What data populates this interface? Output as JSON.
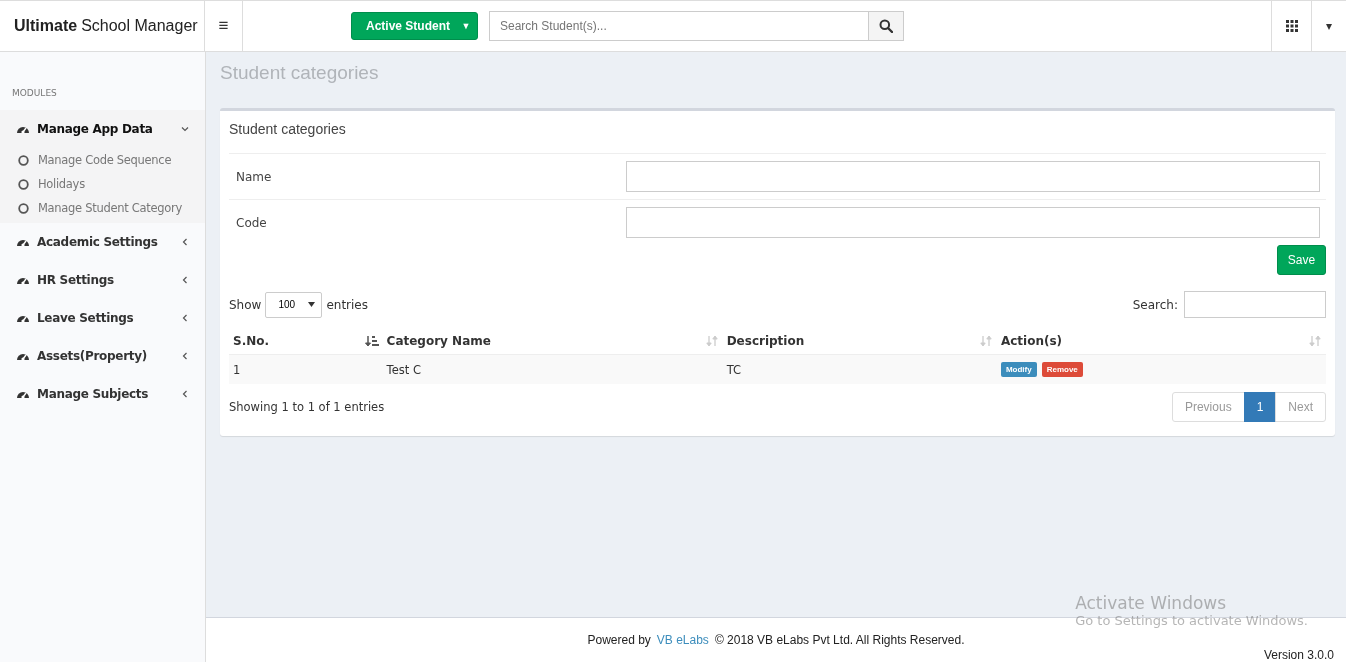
{
  "brand": {
    "bold": "Ultimate",
    "rest": "School Manager"
  },
  "topbar": {
    "menu_icon": "≡",
    "student_button": "Active Student",
    "caret": "▼",
    "search": {
      "placeholder": "Search Student(s)..."
    },
    "right_caret": "▾"
  },
  "sidebar": {
    "heading": "MODULES",
    "items": [
      {
        "label": "Manage App Data",
        "expanded": true,
        "children": [
          {
            "label": "Manage Code Sequence"
          },
          {
            "label": "Holidays"
          },
          {
            "label": "Manage Student Category"
          }
        ]
      },
      {
        "label": "Academic Settings",
        "expanded": false
      },
      {
        "label": "HR Settings",
        "expanded": false
      },
      {
        "label": "Leave Settings",
        "expanded": false
      },
      {
        "label": "Assets(Property)",
        "expanded": false
      },
      {
        "label": "Manage Subjects",
        "expanded": false
      }
    ]
  },
  "page_title": "Student categories",
  "card": {
    "title": "Student categories",
    "fields": [
      {
        "label": "Name"
      },
      {
        "label": "Code"
      }
    ],
    "save_button": "Save",
    "show_label": "Show",
    "page_size": "100",
    "entries_label": "entries",
    "search_label": "Search:",
    "table": {
      "columns": [
        {
          "label": "S.No.",
          "sorted": true
        },
        {
          "label": "Category Name",
          "sorted": false
        },
        {
          "label": "Description",
          "sorted": false
        },
        {
          "label": "Action(s)",
          "sorted": false
        }
      ],
      "rows": [
        {
          "sno": "1",
          "name": "Test C",
          "description": "TC",
          "actions": [
            "Modify",
            "Remove"
          ]
        }
      ]
    },
    "info": "Showing 1 to 1 of 1 entries",
    "pagination": [
      {
        "label": "Previous",
        "selected": false
      },
      {
        "label": "1",
        "selected": true
      },
      {
        "label": "Next",
        "selected": false
      }
    ]
  },
  "footer": {
    "prefix": "Powered by",
    "link": "VB eLabs",
    "suffix": "© 2018 VB eLabs Pvt Ltd. All Rights Reserved.",
    "version": "Version 3.0.0"
  },
  "os_notice": {
    "title": "Activate Windows",
    "text": "Go to Settings to activate Windows."
  }
}
